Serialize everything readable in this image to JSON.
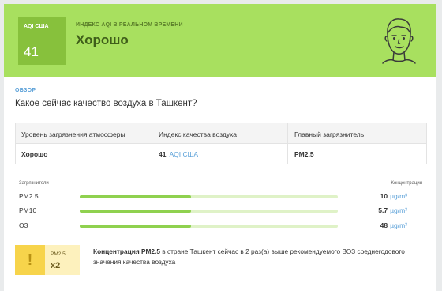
{
  "hero": {
    "aqi_label": "AQI США",
    "aqi_value": "41",
    "subtitle": "ИНДЕКС AQI В РЕАЛЬНОМ ВРЕМЕНИ",
    "status": "Хорошо",
    "face_icon": "smiling-face-icon",
    "colors": {
      "banner": "#a8e05f",
      "badge": "#87c13c"
    }
  },
  "overview": {
    "section_label": "ОБЗОР",
    "question": "Какое сейчас качество воздуха в Ташкент?"
  },
  "table": {
    "headers": [
      "Уровень загрязнения атмосферы",
      "Индекс качества воздуха",
      "Главный загрязнитель"
    ],
    "level": "Хорошо",
    "aqi_value": "41",
    "aqi_unit": "AQI США",
    "main_pollutant": "PM2.5"
  },
  "pollutants": {
    "header_left": "Загрязнители",
    "header_right": "Концентрация",
    "unit": "µg/m³",
    "items": [
      {
        "name": "PM2.5",
        "value": "10",
        "level": 0.43
      },
      {
        "name": "PM10",
        "value": "5.7",
        "level": 0.43
      },
      {
        "name": "O3",
        "value": "48",
        "level": 0.43
      }
    ]
  },
  "warning": {
    "icon": "!",
    "pollutant": "PM2.5",
    "multiplier": "x2",
    "text_bold": "Концентрация PM2.5",
    "text_rest": " в стране Ташкент сейчас в 2 раз(а) выше рекомендуемого ВОЗ среднегодового значения качества воздуха",
    "colors": {
      "icon_bg": "#f7d44b",
      "box_bg": "#fdf1bd"
    }
  }
}
